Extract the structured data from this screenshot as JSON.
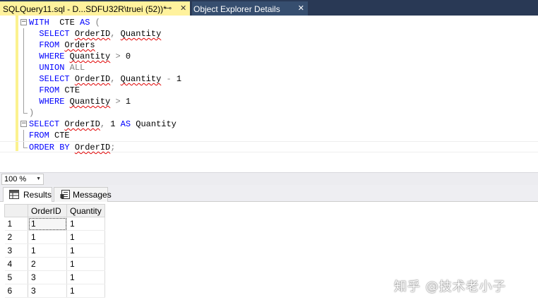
{
  "tabs": {
    "active": {
      "title": "SQLQuery11.sql - D...SDFU32R\\truei (52))*",
      "pin_icon": "pin-icon",
      "close_icon": "close-icon"
    },
    "inactive": {
      "title": "Object Explorer Details",
      "close_icon": "close-icon"
    }
  },
  "editor": {
    "lines": [
      {
        "fold": "minus",
        "tokens": [
          [
            "kw",
            "WITH"
          ],
          [
            "fn",
            "  CTE "
          ],
          [
            "kw",
            "AS"
          ],
          [
            "op",
            " ("
          ]
        ]
      },
      {
        "fold": "line",
        "tokens": [
          [
            "fn",
            "  "
          ],
          [
            "kw",
            "SELECT"
          ],
          [
            "fn",
            " "
          ],
          [
            "sq",
            "OrderID"
          ],
          [
            "op",
            ","
          ],
          [
            "fn",
            " "
          ],
          [
            "sq",
            "Quantity"
          ]
        ]
      },
      {
        "fold": "line",
        "tokens": [
          [
            "fn",
            "  "
          ],
          [
            "kw",
            "FROM"
          ],
          [
            "fn",
            " "
          ],
          [
            "sq",
            "Orders"
          ]
        ]
      },
      {
        "fold": "line",
        "tokens": [
          [
            "fn",
            "  "
          ],
          [
            "kw",
            "WHERE"
          ],
          [
            "fn",
            " "
          ],
          [
            "sq",
            "Quantity"
          ],
          [
            "fn",
            " "
          ],
          [
            "op",
            ">"
          ],
          [
            "fn",
            " 0"
          ]
        ]
      },
      {
        "fold": "line",
        "tokens": [
          [
            "fn",
            "  "
          ],
          [
            "kw",
            "UNION"
          ],
          [
            "fn",
            " "
          ],
          [
            "op",
            "ALL"
          ]
        ]
      },
      {
        "fold": "line",
        "tokens": [
          [
            "fn",
            "  "
          ],
          [
            "kw",
            "SELECT"
          ],
          [
            "fn",
            " "
          ],
          [
            "sq",
            "OrderID"
          ],
          [
            "op",
            ","
          ],
          [
            "fn",
            " "
          ],
          [
            "sq",
            "Quantity"
          ],
          [
            "fn",
            " "
          ],
          [
            "op",
            "-"
          ],
          [
            "fn",
            " 1"
          ]
        ]
      },
      {
        "fold": "line",
        "tokens": [
          [
            "fn",
            "  "
          ],
          [
            "kw",
            "FROM"
          ],
          [
            "fn",
            " CTE"
          ]
        ]
      },
      {
        "fold": "line",
        "tokens": [
          [
            "fn",
            "  "
          ],
          [
            "kw",
            "WHERE"
          ],
          [
            "fn",
            " "
          ],
          [
            "sq",
            "Quantity"
          ],
          [
            "fn",
            " "
          ],
          [
            "op",
            ">"
          ],
          [
            "fn",
            " 1"
          ]
        ]
      },
      {
        "fold": "end",
        "tokens": [
          [
            "op",
            ")"
          ]
        ]
      },
      {
        "fold": "minus",
        "tokens": [
          [
            "kw",
            "SELECT"
          ],
          [
            "fn",
            " "
          ],
          [
            "sq",
            "OrderID"
          ],
          [
            "op",
            ","
          ],
          [
            "fn",
            " 1 "
          ],
          [
            "kw",
            "AS"
          ],
          [
            "fn",
            " Quantity"
          ]
        ]
      },
      {
        "fold": "line",
        "tokens": [
          [
            "kw",
            "FROM"
          ],
          [
            "fn",
            " CTE"
          ]
        ]
      },
      {
        "fold": "end",
        "current": true,
        "tokens": [
          [
            "kw",
            "ORDER BY"
          ],
          [
            "fn",
            " "
          ],
          [
            "sq",
            "OrderID"
          ],
          [
            "op",
            ";"
          ]
        ]
      }
    ]
  },
  "zoom": {
    "value": "100 %"
  },
  "results": {
    "tabs": [
      {
        "label": "Results",
        "icon": "grid-icon"
      },
      {
        "label": "Messages",
        "icon": "messages-icon"
      }
    ],
    "columns": [
      "OrderID",
      "Quantity"
    ],
    "rows": [
      {
        "n": "1",
        "OrderID": "1",
        "Quantity": "1"
      },
      {
        "n": "2",
        "OrderID": "1",
        "Quantity": "1"
      },
      {
        "n": "3",
        "OrderID": "1",
        "Quantity": "1"
      },
      {
        "n": "4",
        "OrderID": "2",
        "Quantity": "1"
      },
      {
        "n": "5",
        "OrderID": "3",
        "Quantity": "1"
      },
      {
        "n": "6",
        "OrderID": "3",
        "Quantity": "1"
      }
    ]
  },
  "watermark": "知乎 @技术老小子",
  "colors": {
    "tab_active_bg": "#fff29d",
    "tab_strip_bg": "#293955",
    "keyword": "#0000ff",
    "operator": "#808080",
    "squiggle": "#e00000"
  }
}
